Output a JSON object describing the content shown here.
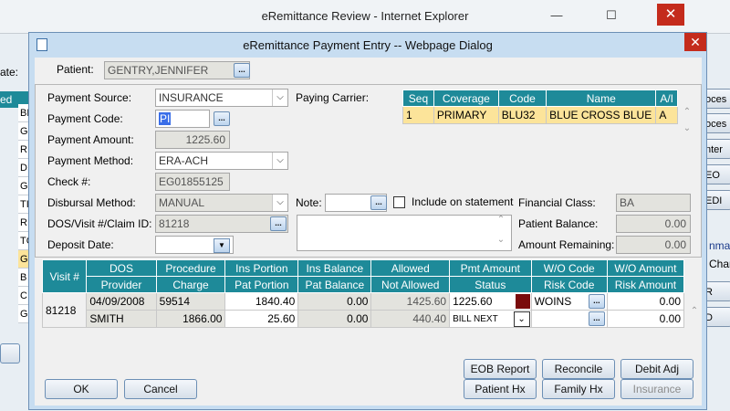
{
  "background_window": {
    "title": "eRemittance Review - Internet Explorer",
    "controls": {
      "minimize": "—",
      "maximize": "☐",
      "close": "✕"
    },
    "left_labels": [
      "ate:",
      "ed"
    ],
    "left_rows": [
      "BL",
      "G",
      "R",
      "D",
      "G",
      "TI",
      "R",
      "TC",
      "G",
      "B",
      "C",
      "G"
    ],
    "right_buttons": [
      "oces",
      "oces",
      "nter",
      "EO",
      "EDI"
    ],
    "right_texts": [
      "nma",
      "Char"
    ],
    "right_buttons_lower": [
      "R",
      "D"
    ]
  },
  "dialog": {
    "title": "eRemittance Payment Entry -- Webpage Dialog",
    "close": "✕",
    "patient": {
      "label": "Patient:",
      "value": "GENTRY,JENNIFER"
    },
    "form": {
      "payment_source": {
        "label": "Payment Source:",
        "value": "INSURANCE"
      },
      "payment_code": {
        "label": "Payment Code:",
        "value": "PI"
      },
      "payment_amount": {
        "label": "Payment Amount:",
        "value": "1225.60"
      },
      "payment_method": {
        "label": "Payment Method:",
        "value": "ERA-ACH"
      },
      "check_no": {
        "label": "Check #:",
        "value": "EG01855125"
      },
      "disbursal_method": {
        "label": "Disbursal Method:",
        "value": "MANUAL"
      },
      "dos_visit_claim": {
        "label": "DOS/Visit #/Claim ID:",
        "value": "81218"
      },
      "deposit_date": {
        "label": "Deposit Date:",
        "value": ""
      },
      "paying_carrier_label": "Paying Carrier:",
      "note_label": "Note:",
      "include_on_statement": "Include on statement",
      "financial_class": {
        "label": "Financial Class:",
        "value": "BA"
      },
      "patient_balance": {
        "label": "Patient Balance:",
        "value": "0.00"
      },
      "amount_remaining": {
        "label": "Amount Remaining:",
        "value": "0.00"
      }
    },
    "carrier_table": {
      "headers": [
        "Seq",
        "Coverage",
        "Code",
        "Name",
        "A/I"
      ],
      "rows": [
        {
          "seq": "1",
          "coverage": "PRIMARY",
          "code": "BLU32",
          "name": "BLUE CROSS BLUE S",
          "ai": "A"
        }
      ]
    },
    "visit_grid": {
      "visit_header": "Visit #",
      "headers_top": [
        "DOS",
        "Procedure",
        "Ins Portion",
        "Ins Balance",
        "Allowed",
        "Pmt Amount",
        "W/O Code",
        "W/O Amount"
      ],
      "headers_bottom": [
        "Provider",
        "Charge",
        "Pat Portion",
        "Pat Balance",
        "Not Allowed",
        "Status",
        "Risk Code",
        "Risk Amount"
      ],
      "visit": "81218",
      "row1": {
        "dos": "04/09/2008",
        "procedure": "59514",
        "ins_portion": "1840.40",
        "ins_balance": "0.00",
        "allowed": "1425.60",
        "pmt_amount": "1225.60",
        "wo_code": "WOINS",
        "wo_amount": "0.00"
      },
      "row2": {
        "provider": "SMITH",
        "charge": "1866.00",
        "pat_portion": "25.60",
        "pat_balance": "0.00",
        "not_allowed": "440.40",
        "status": "BILL NEXT",
        "risk_code": "",
        "risk_amount": "0.00"
      },
      "pmt_flag_color": "#7a0c0c"
    },
    "buttons": {
      "ok": "OK",
      "cancel": "Cancel",
      "eob_report": "EOB Report",
      "reconcile": "Reconcile",
      "debit_adj": "Debit Adj",
      "patient_hx": "Patient Hx",
      "family_hx": "Family Hx",
      "insurance": "Insurance"
    },
    "ellipsis": "..."
  }
}
